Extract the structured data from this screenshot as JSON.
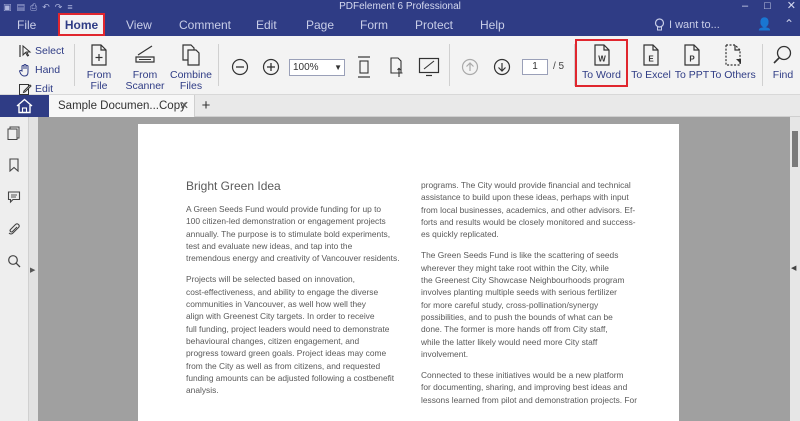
{
  "app": {
    "title": "PDFelement 6 Professional"
  },
  "menu": {
    "items": [
      "File",
      "Home",
      "View",
      "Comment",
      "Edit",
      "Page",
      "Form",
      "Protect",
      "Help"
    ],
    "search_placeholder": "I want to..."
  },
  "ribbon": {
    "select_tools": [
      "Select",
      "Hand",
      "Edit"
    ],
    "create": [
      {
        "label": "From File",
        "icon": "file-plus-icon"
      },
      {
        "label": "From Scanner",
        "icon": "scanner-icon"
      },
      {
        "label": "Combine Files",
        "icon": "combine-files-icon"
      }
    ],
    "zoom_value": "100%",
    "page_current": "1",
    "page_total": "/ 5",
    "convert": [
      {
        "label": "To Word",
        "letter": "W"
      },
      {
        "label": "To Excel",
        "letter": "E"
      },
      {
        "label": "To PPT",
        "letter": "P"
      },
      {
        "label": "To Others",
        "letter": ""
      }
    ],
    "find_label": "Find"
  },
  "tabs": {
    "document": "Sample Documen...Copy"
  },
  "document": {
    "heading": "Bright Green Idea",
    "col_a": [
      [
        "A Green Seeds Fund would provide funding for up to",
        "100 citizen-led demonstration or engagement projects",
        "annually. The purpose is to stimulate bold experiments,",
        "test and evaluate new ideas, and tap into the",
        "tremendous energy and creativity of Vancouver residents."
      ],
      [
        "Projects will be selected based on innovation,",
        "cost-effectiveness, and ability to engage the diverse",
        "communities in Vancouver, as well how well they",
        "align with Greenest City targets. In order to receive",
        "full funding, project leaders would need to demonstrate",
        "behavioural changes, citizen engagement, and",
        "progress toward green goals. Project ideas may come",
        "from the City as well as from citizens, and requested",
        "funding amounts can be adjusted following a costbenefit",
        "analysis."
      ]
    ],
    "col_b": [
      [
        "programs. The City would provide financial and technical",
        "assistance to build upon these ideas, perhaps with input",
        "from local businesses, academics, and other advisors. Ef-",
        "forts and results would be closely monitored and success-",
        "es quickly replicated."
      ],
      [
        "The Green Seeds Fund is like the scattering of seeds",
        "wherever they might take root within the City, while",
        "the Greenest City Showcase Neighbourhoods program",
        "involves planting multiple seeds with serious fertilizer",
        "for more careful study, cross-pollination/synergy",
        "possibilities, and to push the bounds of what can be",
        "done. The former is more hands off from City staff,",
        "while the latter likely would need more City staff",
        "involvement."
      ],
      [
        "Connected to these initiatives would be a new platform",
        "for documenting, sharing, and improving best ideas and",
        "lessons learned from pilot and demonstration projects. For"
      ]
    ]
  },
  "colors": {
    "brand": "#2f3c85",
    "highlight": "#e0262e",
    "ribbon_bg": "#f3f3f3"
  }
}
